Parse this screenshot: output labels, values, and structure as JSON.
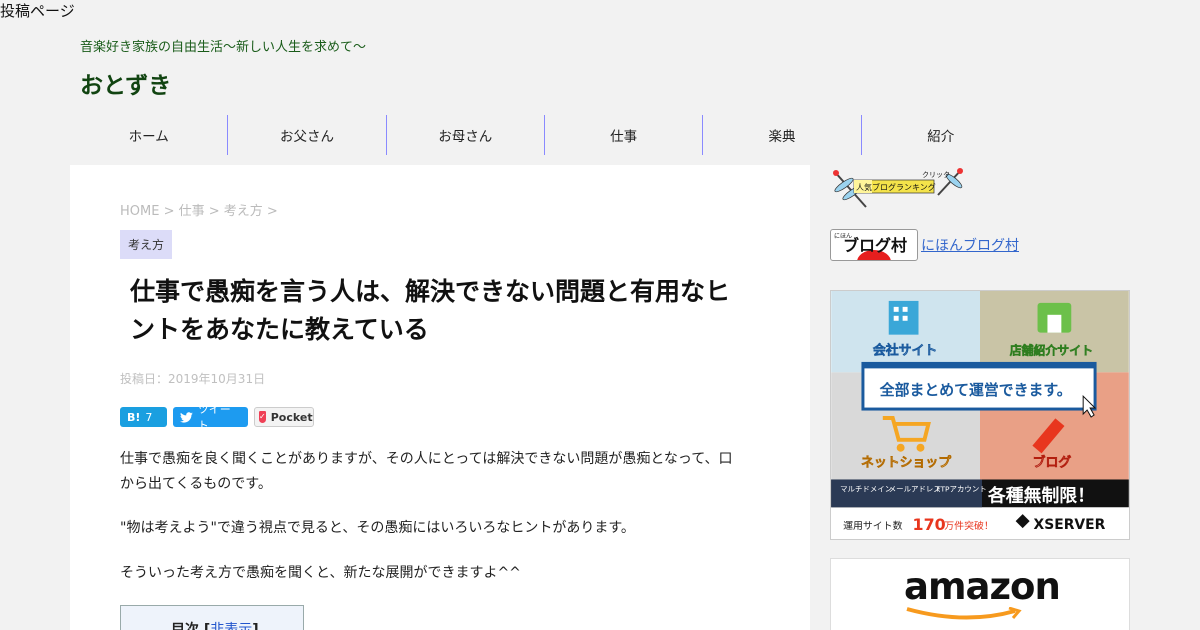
{
  "doc_title": "投稿ページ",
  "site": {
    "tagline": "音楽好き家族の自由生活～新しい人生を求めて～",
    "name": "おとずき"
  },
  "nav": [
    "ホーム",
    "お父さん",
    "お母さん",
    "仕事",
    "楽典",
    "紹介"
  ],
  "post": {
    "breadcrumb": "HOME > 仕事 > 考え方 >",
    "category": "考え方",
    "title": "仕事で愚痴を言う人は、解決できない問題と有用なヒントをあなたに教えている",
    "date": "投稿日：2019年10月31日",
    "share": {
      "hatena_label": "B!",
      "hatena_count": "7",
      "tweet_label": "ツイート",
      "pocket_label": "Pocket"
    },
    "paragraphs": [
      "仕事で愚痴を良く聞くことがありますが、その人にとっては解決できない問題が愚痴となって、口から出てくるものです。",
      "\"物は考えよう\"で違う視点で見ると、その愚痴にはいろいろなヒントがあります。",
      "そういった考え方で愚痴を聞くと、新たな展開ができますよ^^"
    ],
    "toc": {
      "title": "目次",
      "toggle": "非表示"
    }
  },
  "sidebar": {
    "ranking": {
      "top": "クリック",
      "label": "人気ブログランキング"
    },
    "village": {
      "logo_small": "にほん",
      "logo_text": "ブログ村",
      "link": "にほんブログ村"
    },
    "xserver": {
      "corporate": "会社サイト",
      "store": "店舗紹介サイト",
      "center": "全部まとめて運営できます。",
      "shop": "ネットショップ",
      "blog": "ブログ",
      "features": [
        "マルチドメイン",
        "メールアドレス",
        "FTPアカウント"
      ],
      "unlimited": "各種無制限！",
      "count_pre": "運用サイト数",
      "count_num": "170",
      "count_post": "万件突破！",
      "brand": "XSERVER"
    },
    "amazon": "amazon"
  },
  "colors": {
    "nav_divider": "#8a8aff",
    "site_name": "#114411",
    "category_bg": "#dcdcf8",
    "hatena": "#1a9fe0",
    "twitter": "#1d9bf0",
    "pocket": "#ef4056",
    "xserver_blue": "#1a5a9e",
    "xserver_red": "#e8361e"
  }
}
